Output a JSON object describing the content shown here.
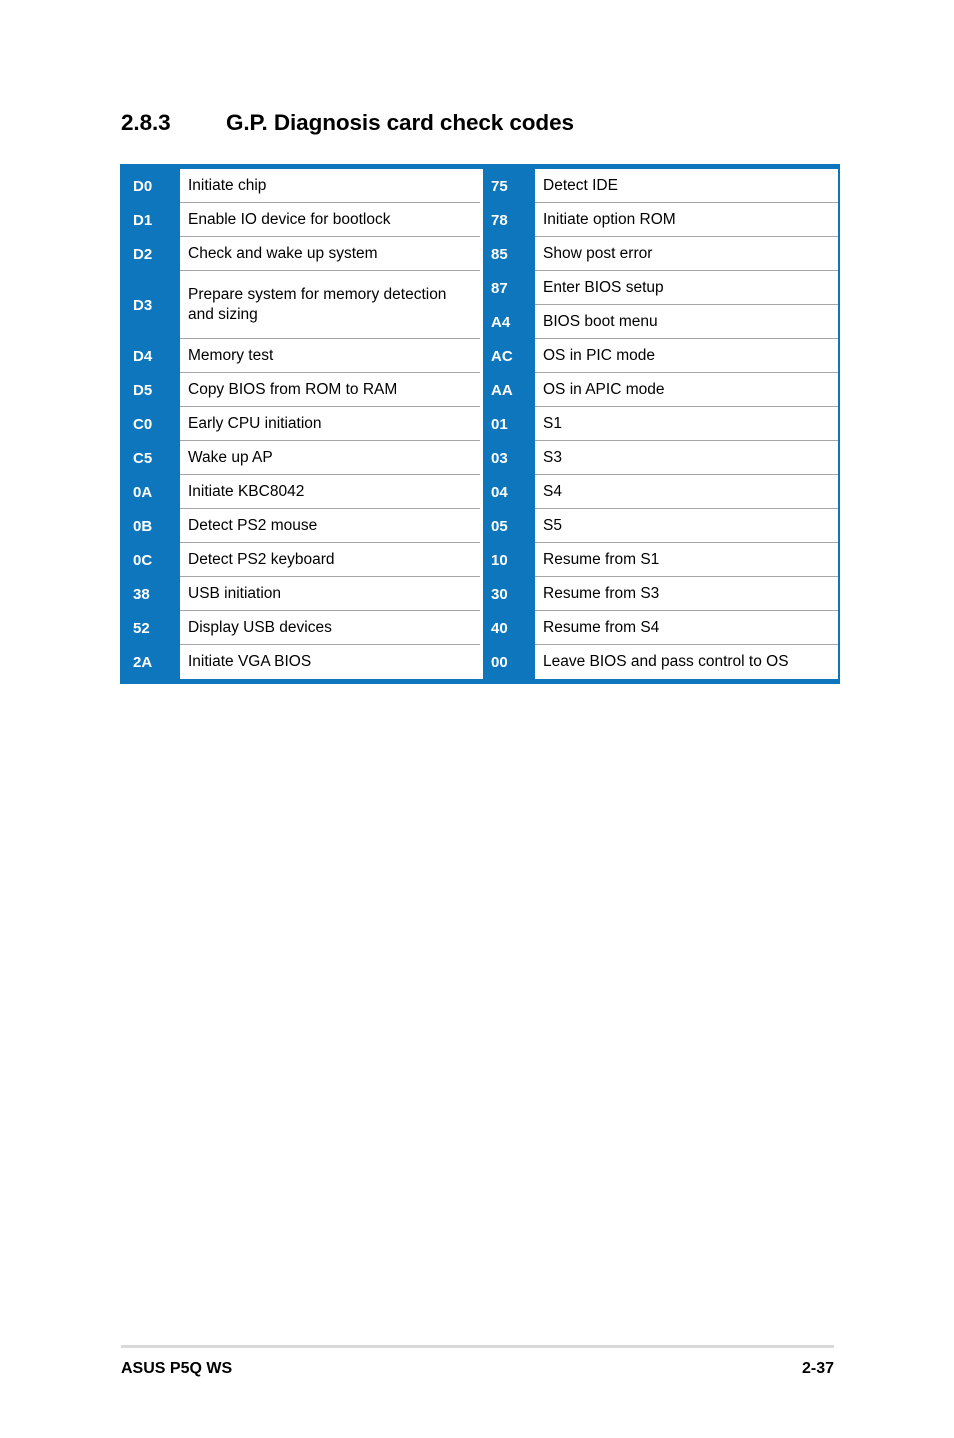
{
  "heading": {
    "number": "2.8.3",
    "title": "G.P. Diagnosis card check codes"
  },
  "table": {
    "accent_color": "#0e76bc",
    "border_color": "#0e76bc",
    "row_separator_color": "#a6a6a6",
    "left_column": [
      {
        "code": "D0",
        "description": "Initiate chip",
        "tall": false
      },
      {
        "code": "D1",
        "description": "Enable IO device for bootlock",
        "tall": false
      },
      {
        "code": "D2",
        "description": "Check and wake up system",
        "tall": false
      },
      {
        "code": "D3",
        "description": "Prepare system for memory detection and sizing",
        "tall": true
      },
      {
        "code": "D4",
        "description": "Memory test",
        "tall": false
      },
      {
        "code": "D5",
        "description": "Copy BIOS from ROM to RAM",
        "tall": false
      },
      {
        "code": "C0",
        "description": "Early CPU initiation",
        "tall": false
      },
      {
        "code": "C5",
        "description": "Wake up AP",
        "tall": false
      },
      {
        "code": "0A",
        "description": "Initiate KBC8042",
        "tall": false
      },
      {
        "code": "0B",
        "description": "Detect PS2 mouse",
        "tall": false
      },
      {
        "code": "0C",
        "description": "Detect PS2 keyboard",
        "tall": false
      },
      {
        "code": "38",
        "description": "USB initiation",
        "tall": false
      },
      {
        "code": "52",
        "description": "Display USB devices",
        "tall": false
      },
      {
        "code": "2A",
        "description": "Initiate VGA BIOS",
        "tall": false
      }
    ],
    "right_column": [
      {
        "code": "75",
        "description": "Detect IDE",
        "tall": false
      },
      {
        "code": "78",
        "description": "Initiate option ROM",
        "tall": false
      },
      {
        "code": "85",
        "description": "Show post error",
        "tall": false
      },
      {
        "code": "87",
        "description": "Enter BIOS setup",
        "tall": false
      },
      {
        "code": "A4",
        "description": "BIOS boot menu",
        "tall": false
      },
      {
        "code": "AC",
        "description": "OS in PIC mode",
        "tall": false
      },
      {
        "code": "AA",
        "description": "OS in APIC mode",
        "tall": false
      },
      {
        "code": "01",
        "description": "S1",
        "tall": false
      },
      {
        "code": "03",
        "description": "S3",
        "tall": false
      },
      {
        "code": "04",
        "description": "S4",
        "tall": false
      },
      {
        "code": "05",
        "description": "S5",
        "tall": false
      },
      {
        "code": "10",
        "description": "Resume from S1",
        "tall": false
      },
      {
        "code": "30",
        "description": "Resume from S3",
        "tall": false
      },
      {
        "code": "40",
        "description": "Resume from S4",
        "tall": false
      },
      {
        "code": "00",
        "description": "Leave BIOS and pass control to OS",
        "tall": false
      }
    ]
  },
  "footer": {
    "left": "ASUS P5Q WS",
    "right": "2-37"
  }
}
